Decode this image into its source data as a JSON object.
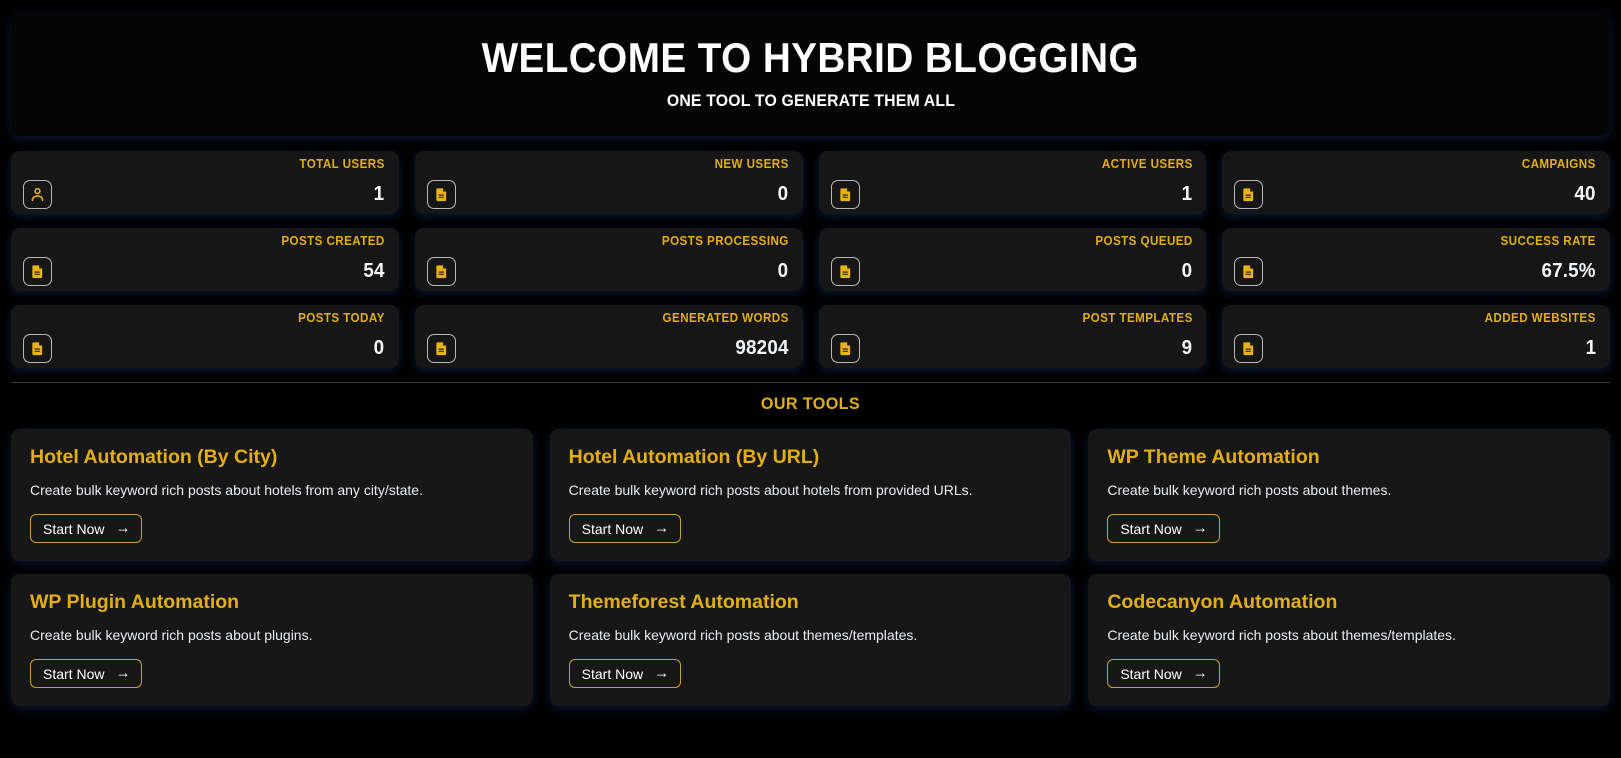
{
  "hero": {
    "title": "WELCOME TO HYBRID BLOGGING",
    "subtitle": "ONE TOOL TO GENERATE THEM ALL"
  },
  "colors": {
    "accent_gold": "#e3ae12",
    "button_border": "#c9a227",
    "card_bg": "#171717",
    "page_bg": "#000000",
    "value_text": "#f2f5f8",
    "glow": "#1e3c82"
  },
  "stats": [
    {
      "label": "TOTAL USERS",
      "value": "1",
      "icon": "user-icon"
    },
    {
      "label": "NEW USERS",
      "value": "0",
      "icon": "document-icon"
    },
    {
      "label": "ACTIVE USERS",
      "value": "1",
      "icon": "document-icon"
    },
    {
      "label": "CAMPAIGNS",
      "value": "40",
      "icon": "document-icon"
    },
    {
      "label": "POSTS CREATED",
      "value": "54",
      "icon": "document-icon"
    },
    {
      "label": "POSTS PROCESSING",
      "value": "0",
      "icon": "document-icon"
    },
    {
      "label": "POSTS QUEUED",
      "value": "0",
      "icon": "document-icon"
    },
    {
      "label": "SUCCESS RATE",
      "value": "67.5%",
      "icon": "document-icon"
    },
    {
      "label": "POSTS TODAY",
      "value": "0",
      "icon": "document-icon"
    },
    {
      "label": "GENERATED WORDS",
      "value": "98204",
      "icon": "document-icon"
    },
    {
      "label": "POST TEMPLATES",
      "value": "9",
      "icon": "document-icon"
    },
    {
      "label": "ADDED WEBSITES",
      "value": "1",
      "icon": "document-icon"
    }
  ],
  "tools_section": {
    "heading": "OUR TOOLS"
  },
  "tools": [
    {
      "title": "Hotel Automation (By City)",
      "description": "Create bulk keyword rich posts about hotels from any city/state.",
      "button": "Start Now",
      "arrow": "→"
    },
    {
      "title": "Hotel Automation (By URL)",
      "description": "Create bulk keyword rich posts about hotels from provided URLs.",
      "button": "Start Now",
      "arrow": "→"
    },
    {
      "title": "WP Theme Automation",
      "description": "Create bulk keyword rich posts about themes.",
      "button": "Start Now",
      "arrow": "→"
    },
    {
      "title": "WP Plugin Automation",
      "description": "Create bulk keyword rich posts about plugins.",
      "button": "Start Now",
      "arrow": "→"
    },
    {
      "title": "Themeforest Automation",
      "description": "Create bulk keyword rich posts about themes/templates.",
      "button": "Start Now",
      "arrow": "→"
    },
    {
      "title": "Codecanyon Automation",
      "description": "Create bulk keyword rich posts about themes/templates.",
      "button": "Start Now",
      "arrow": "→"
    }
  ]
}
